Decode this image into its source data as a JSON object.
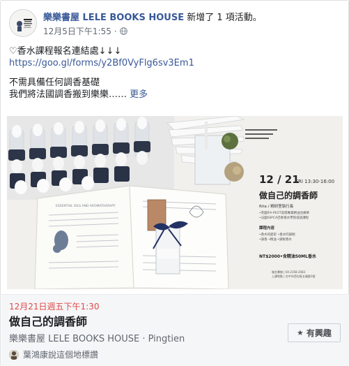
{
  "post": {
    "author_name": "樂樂書屋 LELE BOOKS HOUSE",
    "author_action": " 新增了 1 項活動。",
    "timestamp": "12月5日下午1:55",
    "meta_separator": "·",
    "privacy_icon": "globe-icon",
    "text_line_1": "♡香水課程報名連結處↓↓↓",
    "link": "https://goo.gl/forms/y2Bf0VyFlg6sv3Em1",
    "text_line_2": "不需具備任何調香基礎",
    "text_line_3": "我們將法國調香搬到樂樂……",
    "see_more": " 更多"
  },
  "poster": {
    "date_line": "12 / 21",
    "time": "FRI 13:30-16:00",
    "title": "做自己的調香師",
    "instructor": "Rita / 精研室執行長",
    "credentials": [
      "•英國IFA-PEOT高階專業精油治療師",
      "•法國ISIPCA巴黎香水學院培訓課程"
    ],
    "course_heading": "課程內容",
    "course_items": [
      "•香水的歷史  •香水的調製",
      "•調香  •精油  •調製香水"
    ],
    "price": "NT$2000•含精油50ML香水",
    "contact": [
      "報名專線 | 04-2358-2083",
      "上課地點 | 台中市西屯區五福路1號"
    ],
    "book_label": "ESSENTIAL OILS AND AROMATHERAPY"
  },
  "event": {
    "date": "12月21日週五下午1:30",
    "title": "做自己的調香師",
    "host": "樂樂書屋 LELE BOOKS HOUSE · Pingtien",
    "interested_label": "有興趣",
    "star_icon": "star-icon",
    "friend_line": "葉鴻康說這個地標讚"
  },
  "colors": {
    "link": "#385898",
    "event_date": "#e04848",
    "meta": "#616770",
    "panel": "#f5f6f7"
  }
}
